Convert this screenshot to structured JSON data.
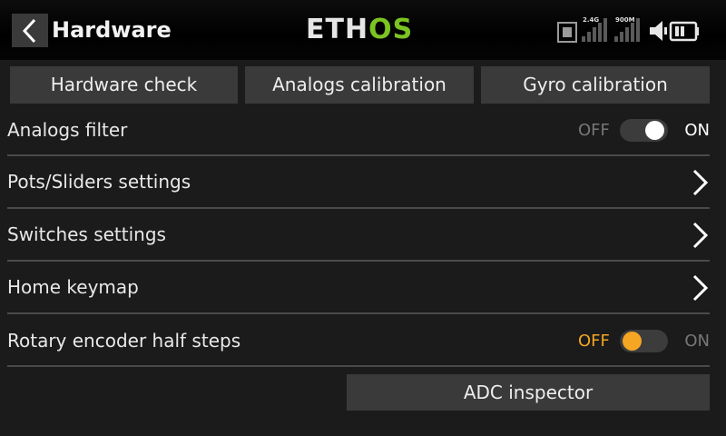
{
  "header": {
    "title": "Hardware",
    "logo": {
      "part1": "ETH",
      "part2": "OS",
      "accent": "#7bc322"
    },
    "status": {
      "rf_label_1": "2.4G",
      "rf_label_2": "900M",
      "icons": [
        "sd-card-icon",
        "signal-24g-icon",
        "signal-900m-icon",
        "speaker-icon",
        "battery-icon"
      ]
    }
  },
  "top_buttons": [
    {
      "label": "Hardware check"
    },
    {
      "label": "Analogs calibration"
    },
    {
      "label": "Gyro calibration"
    }
  ],
  "rows": [
    {
      "label": "Analogs filter",
      "type": "toggle",
      "state": "ON",
      "off_label": "OFF",
      "on_label": "ON"
    },
    {
      "label": "Pots/Sliders settings",
      "type": "submenu"
    },
    {
      "label": "Switches settings",
      "type": "submenu"
    },
    {
      "label": "Home keymap",
      "type": "submenu"
    },
    {
      "label": "Rotary encoder half steps",
      "type": "toggle",
      "state": "OFF",
      "off_label": "OFF",
      "on_label": "ON"
    }
  ],
  "adc_button": {
    "label": "ADC inspector"
  },
  "colors": {
    "active_on": "#ffffff",
    "active_off": "#f5a623",
    "inactive_text": "#777777"
  }
}
